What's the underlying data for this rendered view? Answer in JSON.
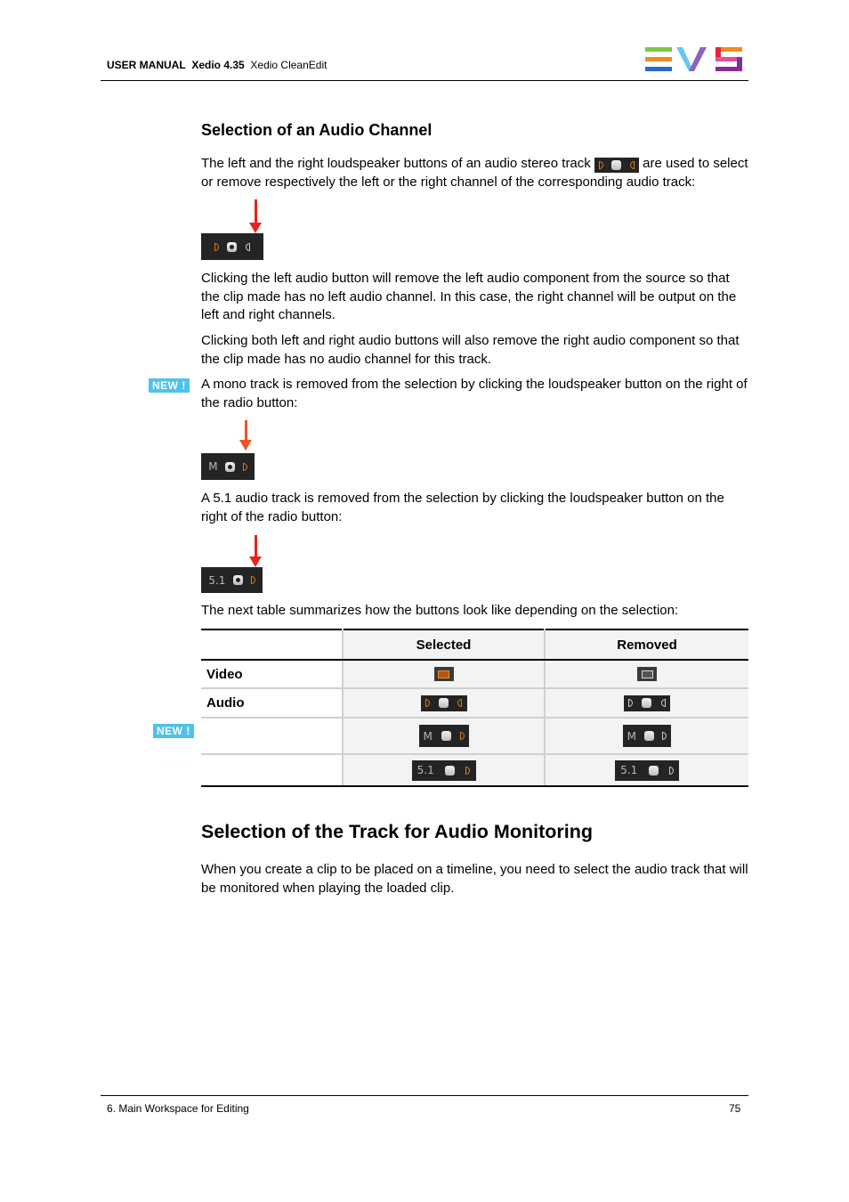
{
  "header": {
    "doc_type": "USER MANUAL",
    "product": "Xedio 4.35",
    "module": "Xedio CleanEdit",
    "logo": "EVS"
  },
  "section1": {
    "title": "Selection of an Audio Channel",
    "intro_part1": "The left and the right loudspeaker buttons of an audio stereo track",
    "intro_part2": "are used to select or remove respectively the left or the right channel of the corresponding audio track:",
    "para1": "Clicking the left audio button will remove the left audio component from the source so that the clip made has no left audio channel. In this case, the right channel will be output on the left and right channels.",
    "para2": "Clicking both left and right audio buttons will also remove the right audio component so that the clip made has no audio channel for this track.",
    "new_badge": "NEW !",
    "mono_para": "A mono track is removed from the selection by clicking the loudspeaker button on the right of the radio button:",
    "mono_label": "M",
    "surround_para": "A 5.1 audio track is removed from the selection by clicking the loudspeaker button on the right of the radio button:",
    "surround_label": "5.1",
    "table_intro": "The next table summarizes how the buttons look like depending on the selection:"
  },
  "table": {
    "headers": [
      "",
      "Selected",
      "Removed"
    ],
    "rows": [
      {
        "label": "Video",
        "selected": "video-icon-orange",
        "removed": "video-icon-grey"
      },
      {
        "label": "Audio",
        "selected": "stereo-both-orange",
        "removed": "stereo-both-grey"
      },
      {
        "label": "",
        "selected": "mono-orange",
        "removed": "mono-grey",
        "mono_label": "M"
      },
      {
        "label": "",
        "selected": "surround-orange",
        "removed": "surround-grey",
        "surround_label": "5.1"
      }
    ],
    "new_badge": "NEW !"
  },
  "section2": {
    "title": "Selection of the Track for Audio Monitoring",
    "para": "When you create a clip to be placed on a timeline, you need to select the audio track that will be monitored when playing the loaded clip."
  },
  "footer": {
    "chapter": "6. Main Workspace for Editing",
    "page": "75"
  },
  "colors": {
    "accent_orange": "#e07a10",
    "arrow_red": "#e8231a",
    "new_badge": "#4fc1ec",
    "widget_bg": "#242424"
  }
}
